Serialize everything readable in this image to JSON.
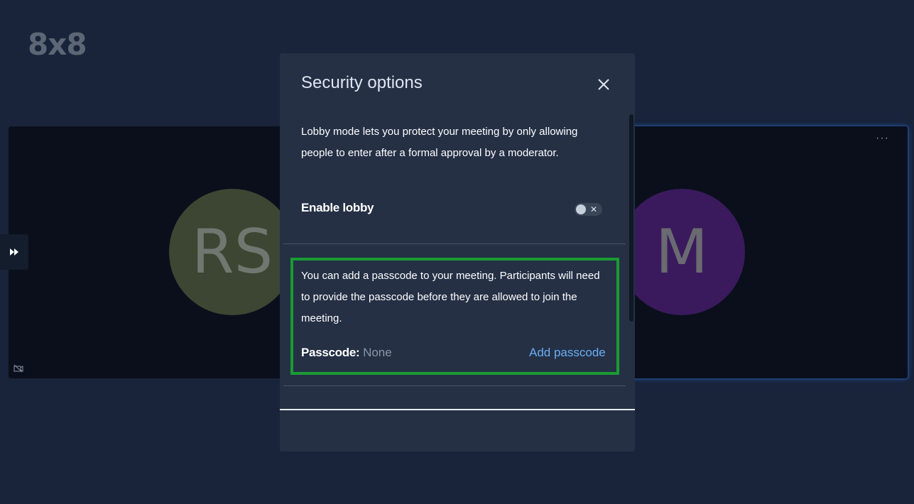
{
  "app": {
    "logo": "8x8"
  },
  "participants": [
    {
      "initials": "RS",
      "color": "#3c4632"
    },
    {
      "initials": "M",
      "color": "#3a1a5c"
    }
  ],
  "tile_menu": "···",
  "modal": {
    "title": "Security options",
    "lobby": {
      "description": "Lobby mode lets you protect your meeting by only allowing people to enter after a formal approval by a moderator.",
      "toggle_label": "Enable lobby",
      "enabled": false
    },
    "passcode": {
      "description": "You can add a passcode to your meeting. Participants will need to provide the passcode before they are allowed to join the meeting.",
      "label": "Passcode:",
      "value": "None",
      "add_label": "Add passcode"
    }
  },
  "colors": {
    "background": "#19233a",
    "modal": "#253045",
    "accent_link": "#6aaef2",
    "highlight_border": "#1a9b33",
    "active_tile_border": "#1e4f9a"
  }
}
